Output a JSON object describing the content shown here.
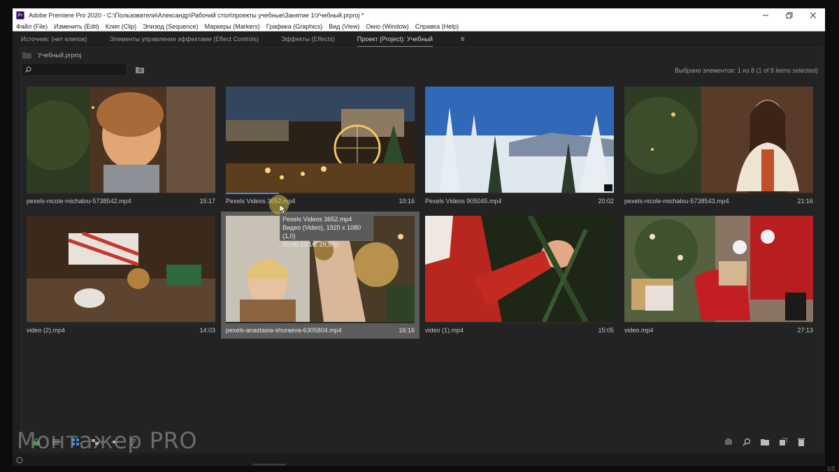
{
  "window": {
    "title": "Adobe Premiere Pro 2020 - C:\\Пользователи\\Александр\\Рабочий стол\\проекты учебные\\Занятие 1\\Учебный.prproj *",
    "app_icon": "Pr",
    "controls": [
      "minimize-icon",
      "restore-icon",
      "close-icon"
    ]
  },
  "menu": [
    "Файл (File)",
    "Изменить (Edit)",
    "Клип (Clip)",
    "Эпизод (Sequence)",
    "Маркеры (Markers)",
    "Графика (Graphics)",
    "Вид (View)",
    "Окно (Window)",
    "Справка (Help)"
  ],
  "tabs": [
    {
      "label": "Источник: (нет клипов)",
      "active": false
    },
    {
      "label": "Элементы управления эффектами (Effect Controls)",
      "active": false
    },
    {
      "label": "Эффекты (Effects)",
      "active": false
    },
    {
      "label": "Проект (Project): Учебный",
      "active": true
    }
  ],
  "tab_menu_icon": "≡",
  "project": {
    "file_name": "Учебный.prproj",
    "search_value": "",
    "selected_info": "Выбрано элементов: 1 из 8 (1 of 8 items selected)"
  },
  "clips": [
    {
      "name": "pexels-nicole-michalou-5738542.mp4",
      "duration": "15:17"
    },
    {
      "name": "Pexels Videos 3652.mp4",
      "duration": "10:16",
      "progress": 0.28
    },
    {
      "name": "Pexels Videos 905045.mp4",
      "duration": "20:02"
    },
    {
      "name": "pexels-nicole-michalou-5738543.mp4",
      "duration": "21:16"
    },
    {
      "name": "video (2).mp4",
      "duration": "14:03"
    },
    {
      "name": "pexels-anastasia-shuraeva-6305804.mp4",
      "duration": "16:16"
    },
    {
      "name": "video (1).mp4",
      "duration": "15:05"
    },
    {
      "name": "video.mp4",
      "duration": "27:13"
    }
  ],
  "tooltip": {
    "line1": "Pexels Videos 3652.mp4",
    "line2": "Видео (Video), 1920 x 1080 (1,0)",
    "line3": "00:00:10:16, 29,97p"
  },
  "watermark": "Монтажер PRO",
  "page_info": "1/3",
  "colors": {
    "panel_bg": "#232323",
    "selected_clip_bg": "#5c5c5c",
    "progress_blue": "#3f8ae0",
    "tooltip_bg": "#5b5b5b"
  }
}
